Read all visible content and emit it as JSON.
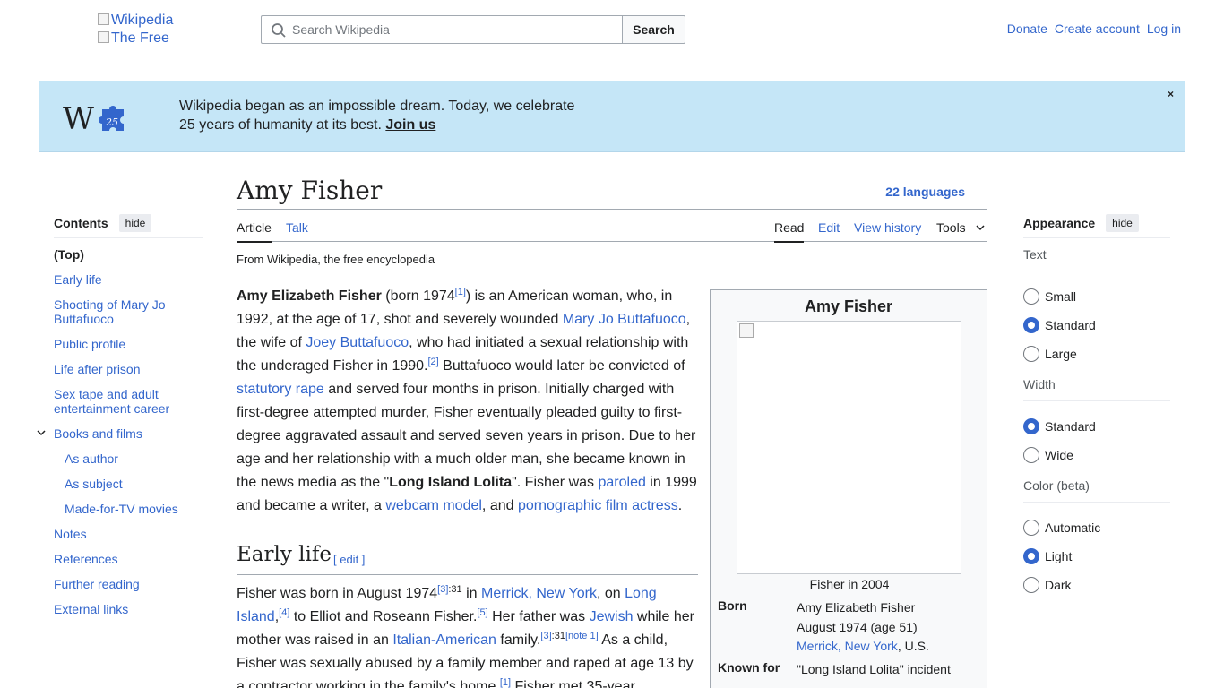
{
  "header": {
    "logo_alt": "Wikipedia",
    "logo_alt2": "The Free",
    "search_placeholder": "Search Wikipedia",
    "search_button": "Search",
    "donate": "Donate",
    "create_account": "Create account",
    "log_in": "Log in"
  },
  "banner": {
    "line1": "Wikipedia began as an impossible dream. Today, we celebrate",
    "line2_prefix": "25 years of humanity at its best.",
    "join": "Join us",
    "close": "×",
    "logo_badge": "25"
  },
  "toc": {
    "title": "Contents",
    "hide": "hide",
    "items": [
      {
        "label": "(Top)"
      },
      {
        "label": "Early life"
      },
      {
        "label": "Shooting of Mary Jo Buttafuoco"
      },
      {
        "label": "Public profile"
      },
      {
        "label": "Life after prison"
      },
      {
        "label": "Sex tape and adult entertainment career"
      },
      {
        "label": "Books and films"
      },
      {
        "label": "As author"
      },
      {
        "label": "As subject"
      },
      {
        "label": "Made-for-TV movies"
      },
      {
        "label": "Notes"
      },
      {
        "label": "References"
      },
      {
        "label": "Further reading"
      },
      {
        "label": "External links"
      }
    ]
  },
  "article": {
    "title": "Amy Fisher",
    "languages": "22 languages",
    "tabs": {
      "article": "Article",
      "talk": "Talk",
      "read": "Read",
      "edit": "Edit",
      "history": "View history",
      "tools": "Tools"
    },
    "tagline": "From Wikipedia, the free encyclopedia",
    "intro": {
      "name": "Amy Elizabeth Fisher",
      "born": " (born 1974",
      "ref1": "[1]",
      "t1": ") is an American woman, who, in 1992, at the age of 17, shot and severely wounded ",
      "l1": "Mary Jo Buttafuoco",
      "t2": ", the wife of ",
      "l2": "Joey Buttafuoco",
      "t3": ", who had initiated a sexual relationship with the underaged Fisher in 1990.",
      "ref2": "[2]",
      "t4": " Buttafuoco would later be convicted of ",
      "l3": "statutory rape",
      "t5": " and served four months in prison. Initially charged with first-degree attempted murder, Fisher eventually pleaded guilty to first-degree aggravated assault and served seven years in prison. Due to her age and her relationship with a much older man, she became known in the news media as the \"",
      "nick": "Long Island Lolita",
      "t6": "\". Fisher was ",
      "l4": "paroled",
      "t7": " in 1999 and became a writer, a ",
      "l5": "webcam model",
      "t8": ", and ",
      "l6": "pornographic film actress",
      "t9": "."
    },
    "early_life": {
      "heading": "Early life",
      "edit": "[ edit ]",
      "t1": "Fisher was born in August 1974",
      "ref3": "[3]",
      "p31a": ":31",
      "t2": " in ",
      "l1": "Merrick, New York",
      "t3": ", on ",
      "l2": "Long Island",
      "t4": ",",
      "ref4": "[4]",
      "t5": " to Elliot and Roseann Fisher.",
      "ref5": "[5]",
      "t6": " Her father was ",
      "l3": "Jewish",
      "t7": " while her mother was raised in an ",
      "l4": "Italian-American",
      "t8": " family.",
      "ref3b": "[3]",
      "p31b": ":31",
      "note1": "[note 1]",
      "t9": " As a child, Fisher was sexually abused by a family member and raped at age 13 by a contractor working in the family's home.",
      "ref1": "[1]",
      "t10": " Fisher met 35-year"
    }
  },
  "infobox": {
    "title": "Amy Fisher",
    "caption": "Fisher in 2004",
    "born_label": "Born",
    "born_name": "Amy Elizabeth Fisher",
    "born_date": "August 1974 (age 51)",
    "born_place_link": "Merrick, New York",
    "born_place_rest": ", U.S.",
    "known_label": "Known for",
    "known_value": "\"Long Island Lolita\" incident"
  },
  "appearance": {
    "title": "Appearance",
    "hide": "hide",
    "text_label": "Text",
    "text_options": [
      "Small",
      "Standard",
      "Large"
    ],
    "text_selected": "Standard",
    "width_label": "Width",
    "width_options": [
      "Standard",
      "Wide"
    ],
    "width_selected": "Standard",
    "color_label": "Color (beta)",
    "color_options": [
      "Automatic",
      "Light",
      "Dark"
    ],
    "color_selected": "Light"
  },
  "colors": {
    "link": "#3366cc",
    "banner_bg": "#c5e6f7",
    "infobox_bg": "#f8f9fa",
    "text": "#202122"
  }
}
